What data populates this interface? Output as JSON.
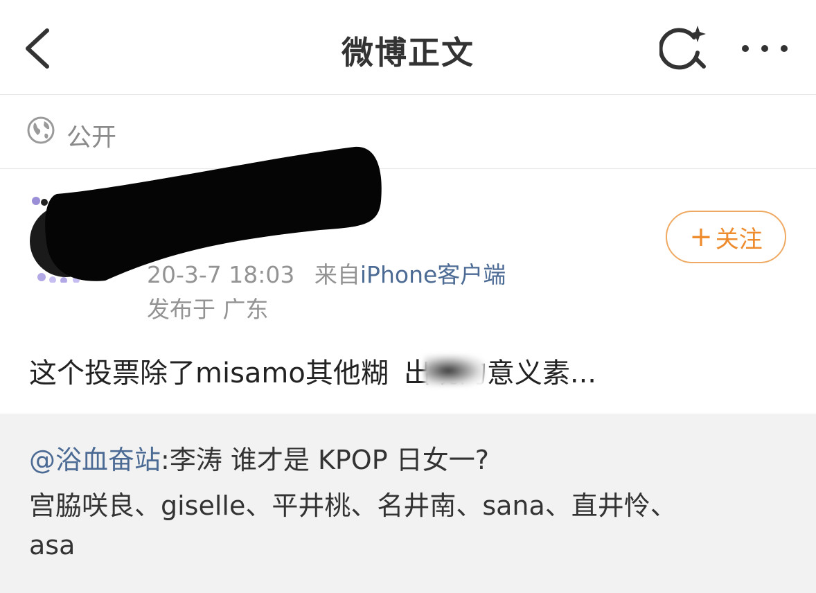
{
  "nav": {
    "title": "微博正文",
    "back_icon": "chevron-left-icon",
    "search_icon": "search-sparkle-icon",
    "more_icon": "more-dots-icon"
  },
  "visibility": {
    "icon": "globe-icon",
    "label": "公开"
  },
  "post": {
    "timestamp_visible": "20-3-7 18:03",
    "source_prefix": "来自",
    "source": "iPhone客户端",
    "location": "发布于 广东",
    "text_before": "这个投票除了misamo其他糊",
    "text_after": "出现的意义素...",
    "follow": {
      "plus": "+",
      "label": "关注"
    }
  },
  "repost": {
    "mention": "@浴血奋站",
    "line1_rest": ":李涛 谁才是 KPOP 日女一?",
    "line2": "宫脇咲良、giselle、平井桃、名井南、sana、直井怜、",
    "line3": "asa"
  },
  "colors": {
    "accent_orange": "#ee8b2d",
    "link_blue": "#4b6a94",
    "muted_gray": "#939393",
    "repost_bg": "#f2f2f2"
  }
}
